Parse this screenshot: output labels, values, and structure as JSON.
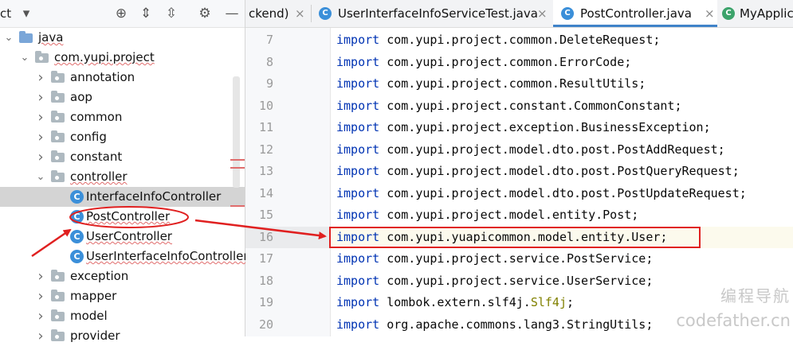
{
  "project_panel": {
    "header_text": "ct",
    "tree": [
      {
        "label": "java",
        "indent": 0,
        "chevron": "down",
        "icon": "source-folder",
        "squiggle": true
      },
      {
        "label": "com.yupi.project",
        "indent": 1,
        "chevron": "down",
        "icon": "package-folder",
        "squiggle": true
      },
      {
        "label": "annotation",
        "indent": 2,
        "chevron": "right",
        "icon": "package-folder",
        "squiggle": false
      },
      {
        "label": "aop",
        "indent": 2,
        "chevron": "right",
        "icon": "package-folder",
        "squiggle": false
      },
      {
        "label": "common",
        "indent": 2,
        "chevron": "right",
        "icon": "package-folder",
        "squiggle": false
      },
      {
        "label": "config",
        "indent": 2,
        "chevron": "right",
        "icon": "package-folder",
        "squiggle": false
      },
      {
        "label": "constant",
        "indent": 2,
        "chevron": "right",
        "icon": "package-folder",
        "squiggle": false
      },
      {
        "label": "controller",
        "indent": 2,
        "chevron": "down",
        "icon": "package-folder",
        "squiggle": true
      },
      {
        "label": "InterfaceInfoController",
        "indent": 3,
        "chevron": "",
        "icon": "class",
        "squiggle": false,
        "selected": true
      },
      {
        "label": "PostController",
        "indent": 3,
        "chevron": "",
        "icon": "class",
        "squiggle": true
      },
      {
        "label": "UserController",
        "indent": 3,
        "chevron": "",
        "icon": "class",
        "squiggle": true
      },
      {
        "label": "UserInterfaceInfoController",
        "indent": 3,
        "chevron": "",
        "icon": "class",
        "squiggle": true
      },
      {
        "label": "exception",
        "indent": 2,
        "chevron": "right",
        "icon": "package-folder",
        "squiggle": false
      },
      {
        "label": "mapper",
        "indent": 2,
        "chevron": "right",
        "icon": "package-folder",
        "squiggle": false
      },
      {
        "label": "model",
        "indent": 2,
        "chevron": "right",
        "icon": "package-folder",
        "squiggle": false
      },
      {
        "label": "provider",
        "indent": 2,
        "chevron": "right",
        "icon": "package-folder",
        "squiggle": false
      }
    ]
  },
  "tabs": [
    {
      "label": "ckend)",
      "icon": "",
      "active": false
    },
    {
      "label": "UserInterfaceInfoServiceTest.java",
      "icon": "test-class",
      "active": false
    },
    {
      "label": "PostController.java",
      "icon": "class",
      "active": true
    },
    {
      "label": "MyApplic",
      "icon": "application",
      "active": false
    }
  ],
  "editor": {
    "lines": [
      {
        "num": "7",
        "keyword": "import",
        "path": "com.yupi.project.common.DeleteRequest",
        "cls": "",
        "end": ";"
      },
      {
        "num": "8",
        "keyword": "import",
        "path": "com.yupi.project.common.ErrorCode",
        "cls": "",
        "end": ";"
      },
      {
        "num": "9",
        "keyword": "import",
        "path": "com.yupi.project.common.ResultUtils",
        "cls": "",
        "end": ";"
      },
      {
        "num": "10",
        "keyword": "import",
        "path": "com.yupi.project.constant.CommonConstant",
        "cls": "",
        "end": ";"
      },
      {
        "num": "11",
        "keyword": "import",
        "path": "com.yupi.project.exception.BusinessException",
        "cls": "",
        "end": ";"
      },
      {
        "num": "12",
        "keyword": "import",
        "path": "com.yupi.project.model.dto.post.PostAddRequest",
        "cls": "",
        "end": ";"
      },
      {
        "num": "13",
        "keyword": "import",
        "path": "com.yupi.project.model.dto.post.PostQueryRequest",
        "cls": "",
        "end": ";"
      },
      {
        "num": "14",
        "keyword": "import",
        "path": "com.yupi.project.model.dto.post.PostUpdateRequest",
        "cls": "",
        "end": ";"
      },
      {
        "num": "15",
        "keyword": "import",
        "path": "com.yupi.project.model.entity.Post",
        "cls": "",
        "end": ";"
      },
      {
        "num": "16",
        "keyword": "import",
        "path": "com.yupi.yuapicommon.model.entity.User",
        "cls": "",
        "end": ";"
      },
      {
        "num": "17",
        "keyword": "import",
        "path": "com.yupi.project.service.PostService",
        "cls": "",
        "end": ";"
      },
      {
        "num": "18",
        "keyword": "import",
        "path": "com.yupi.project.service.UserService",
        "cls": "",
        "end": ";"
      },
      {
        "num": "19",
        "keyword": "import",
        "path": "lombok.extern.slf4j.",
        "cls": "Slf4j",
        "end": ";"
      },
      {
        "num": "20",
        "keyword": "import",
        "path": "org.apache.commons.lang3.StringUtils",
        "cls": "",
        "end": ";"
      }
    ]
  },
  "watermark": {
    "cn": "编程导航",
    "en": "codefather.cn"
  },
  "colors": {
    "keyword": "#0033b3",
    "annotation_red": "#e02020",
    "selection": "#d4d4d4",
    "tab_accent": "#4083c9"
  }
}
